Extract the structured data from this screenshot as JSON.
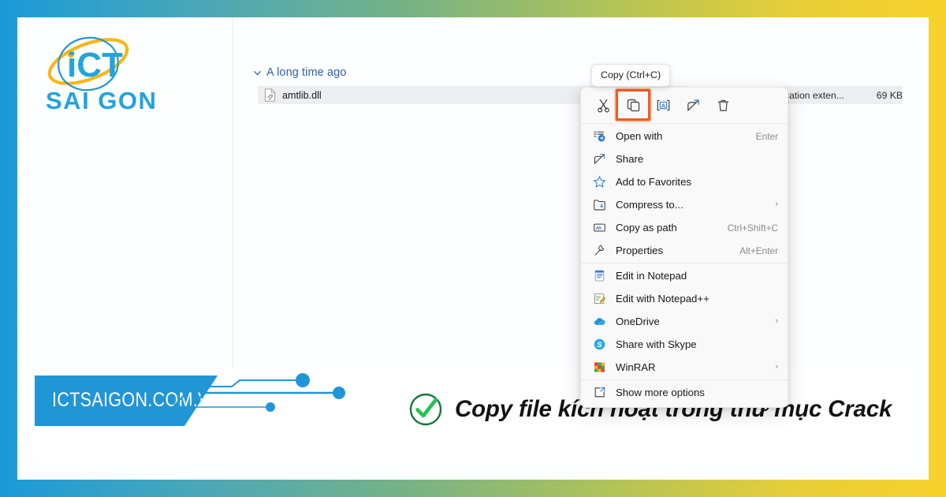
{
  "brand": {
    "logo_text_main": "iCT",
    "logo_text_sub": "SAI GON",
    "website": "ICTSAIGON.COM.VN",
    "accent_blue": "#1a9ad9",
    "accent_yellow": "#f8d22c",
    "frame_gradient_from": "#1a9ad9",
    "frame_gradient_to": "#f8d22c"
  },
  "caption": {
    "icon": "check-circle-icon",
    "text": "Copy file kích hoạt trong thư mục Crack",
    "check_color": "#22b24c"
  },
  "explorer": {
    "group_header": {
      "icon": "chevron-down-icon",
      "label": "A long time ago"
    },
    "file_row": {
      "icon": "dll-file-icon",
      "name": "amtlib.dll",
      "type": "cation exten...",
      "size": "69 KB"
    }
  },
  "tooltip": {
    "text": "Copy (Ctrl+C)"
  },
  "context_menu": {
    "toolbar": [
      {
        "name": "cut-icon",
        "label": "Cut",
        "highlighted": false
      },
      {
        "name": "copy-icon",
        "label": "Copy",
        "highlighted": true
      },
      {
        "name": "rename-icon",
        "label": "Rename",
        "highlighted": false
      },
      {
        "name": "share-icon",
        "label": "Share",
        "highlighted": false
      },
      {
        "name": "delete-icon",
        "label": "Delete",
        "highlighted": false
      }
    ],
    "highlight_color": "#f05a28",
    "groups": [
      {
        "items": [
          {
            "icon": "open-with-icon",
            "label": "Open with",
            "accel": "Enter",
            "submenu": false
          },
          {
            "icon": "share-icon",
            "label": "Share",
            "accel": "",
            "submenu": false
          },
          {
            "icon": "star-icon",
            "label": "Add to Favorites",
            "accel": "",
            "submenu": false
          },
          {
            "icon": "compress-icon",
            "label": "Compress to...",
            "accel": "",
            "submenu": true
          },
          {
            "icon": "copy-as-path-icon",
            "label": "Copy as path",
            "accel": "Ctrl+Shift+C",
            "submenu": false
          },
          {
            "icon": "properties-icon",
            "label": "Properties",
            "accel": "Alt+Enter",
            "submenu": false
          }
        ]
      },
      {
        "items": [
          {
            "icon": "notepad-icon",
            "label": "Edit in Notepad",
            "accel": "",
            "submenu": false
          },
          {
            "icon": "notepadpp-icon",
            "label": "Edit with Notepad++",
            "accel": "",
            "submenu": false
          },
          {
            "icon": "onedrive-icon",
            "label": "OneDrive",
            "accel": "",
            "submenu": true
          },
          {
            "icon": "skype-icon",
            "label": "Share with Skype",
            "accel": "",
            "submenu": false
          },
          {
            "icon": "winrar-icon",
            "label": "WinRAR",
            "accel": "",
            "submenu": true
          }
        ]
      },
      {
        "items": [
          {
            "icon": "show-more-icon",
            "label": "Show more options",
            "accel": "",
            "submenu": false
          }
        ]
      }
    ]
  }
}
